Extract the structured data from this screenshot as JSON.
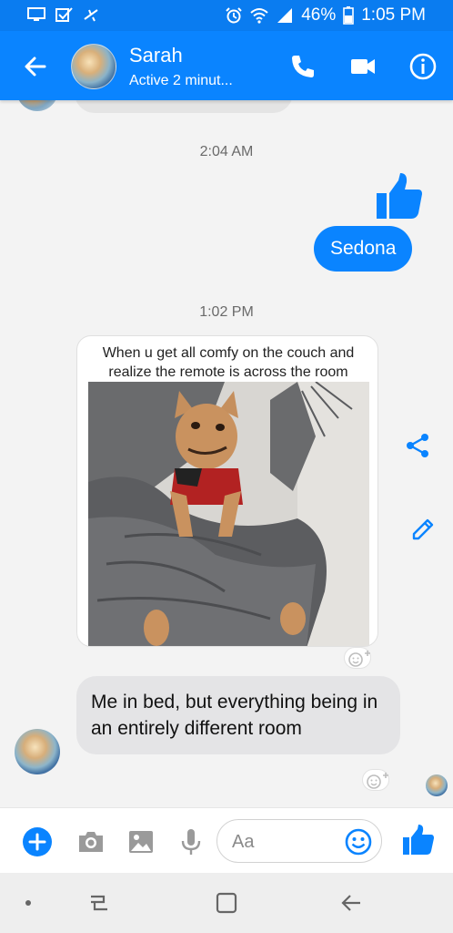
{
  "status_bar": {
    "battery": "46%",
    "time": "1:05 PM",
    "icons": [
      "screen-cast-icon",
      "checkbox-icon",
      "airplane-icon",
      "alarm-icon",
      "wifi-icon",
      "signal-icon",
      "battery-icon"
    ]
  },
  "header": {
    "name": "Sarah",
    "status": "Active 2 minut...",
    "icons": [
      "back-arrow-icon",
      "phone-icon",
      "video-camera-icon",
      "info-icon"
    ]
  },
  "messages": {
    "timestamp_1": "2:04 AM",
    "sent_text": "Sedona",
    "timestamp_2": "1:02 PM",
    "meme_caption": "When u get all comfy on the couch and realize the remote is across the room",
    "received_text": "Me in bed, but everything being in an entirely different room"
  },
  "composer": {
    "placeholder": "Aa",
    "icons": [
      "plus-icon",
      "camera-icon",
      "image-icon",
      "microphone-icon",
      "emoji-icon",
      "thumbs-up-icon"
    ]
  },
  "colors": {
    "brand": "#0a84ff",
    "status_bar": "#0a7cf0",
    "received_bubble": "#e4e4e6",
    "background": "#f3f3f3"
  }
}
